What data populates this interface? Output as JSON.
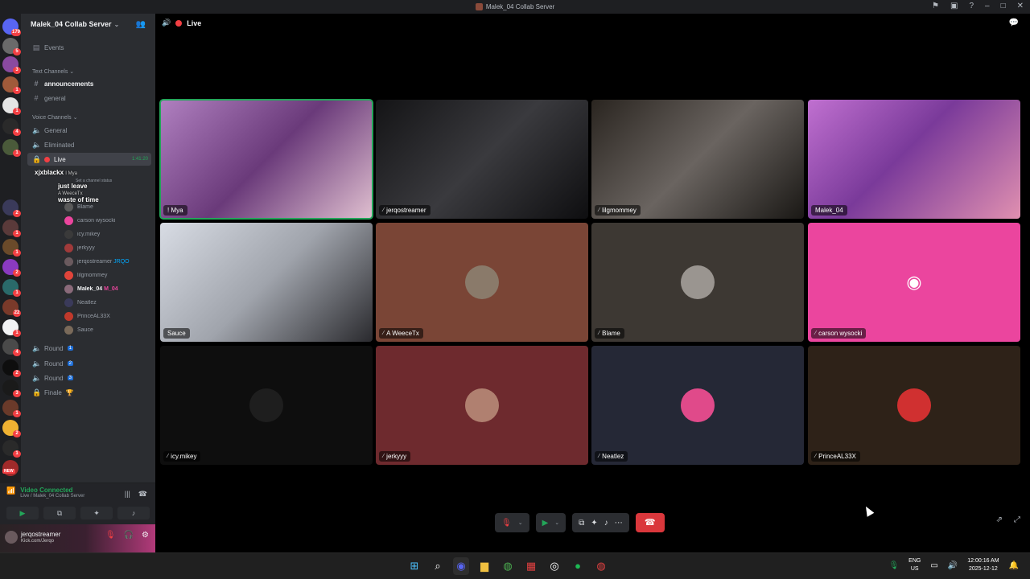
{
  "window": {
    "title": "Malek_04 Collab Server"
  },
  "server": {
    "name": "Malek_04 Collab Server"
  },
  "channels": {
    "events": "Events",
    "text_category": "Text Channels",
    "announcements": "announcements",
    "general_text": "general",
    "voice_category": "Voice Channels",
    "general_voice": "General",
    "eliminated": "Eliminated",
    "live": "Live",
    "live_timer": "1:41:20",
    "status_hint": "Set a channel status",
    "round1": "Round",
    "round2": "Round",
    "round3": "Round",
    "finale": "Finale"
  },
  "overlay_chat": [
    {
      "user": "xjxblackx",
      "message": "",
      "sub": "I Mya"
    },
    {
      "user": "",
      "message": "just leave",
      "sub": "A WeeceTx"
    },
    {
      "user": "",
      "message": "waste of time",
      "sub": ""
    }
  ],
  "voice_members": [
    {
      "name": "I Mya",
      "color": "#c97aa8"
    },
    {
      "name": "A WeeceTx",
      "color": "#8a5a40"
    },
    {
      "name": "Blame",
      "color": "#5a5a5a"
    },
    {
      "name": "carson wysocki",
      "color": "#eb459e"
    },
    {
      "name": "icy.mikey",
      "color": "#3a3a3a"
    },
    {
      "name": "jerkyyy",
      "color": "#a03a3a"
    },
    {
      "name": "jerqostreamer",
      "tag": "JRQO",
      "color": "#6a5a5e"
    },
    {
      "name": "lilgmommey",
      "color": "#e0443a"
    },
    {
      "name": "Malek_04",
      "tag": "M_04",
      "color": "#8a6a7a"
    },
    {
      "name": "Neatlez",
      "color": "#3a3a5a"
    },
    {
      "name": "PrinceAL33X",
      "color": "#c0392b"
    },
    {
      "name": "Sauce",
      "color": "#7a6a5a"
    }
  ],
  "voice_panel": {
    "status": "Video Connected",
    "channel": "Live / Malek_04 Collab Server"
  },
  "user": {
    "name": "jerqostreamer",
    "status": "Kick.com/Jerqo"
  },
  "call": {
    "channel": "Live"
  },
  "tiles": [
    {
      "name": "! Mya",
      "bg": "#7a4a8a",
      "video": true,
      "speaking": true
    },
    {
      "name": "jerqostreamer",
      "bg": "#2a2a2e",
      "video": true
    },
    {
      "name": "lilgmommey",
      "bg": "#3a3530",
      "video": true
    },
    {
      "name": "Malek_04",
      "bg": "#9a5ab0",
      "video": true
    },
    {
      "name": "Sauce",
      "bg": "#b8bcc4",
      "video": true
    },
    {
      "name": "A WeeceTx",
      "bg": "#7a4536",
      "avatar": "#8a7a6a"
    },
    {
      "name": "Blame",
      "bg": "#3d3833",
      "avatar": "#9a9590"
    },
    {
      "name": "carson wysocki",
      "bg": "#eb459e",
      "discord": true
    },
    {
      "name": "icy.mikey",
      "bg": "#0e0e0e",
      "avatar": "#1e1e1e"
    },
    {
      "name": "jerkyyy",
      "bg": "#6e2a2e",
      "avatar": "#b08070"
    },
    {
      "name": "Neatlez",
      "bg": "#252836",
      "avatar": "#e04a8a"
    },
    {
      "name": "PrinceAL33X",
      "bg": "#2e2218",
      "avatar": "#d03030"
    }
  ],
  "icons": {
    "mic_off": "microphone-muted-icon",
    "camera": "camera-icon",
    "screenshare": "screen-share-icon",
    "activities": "activities-icon",
    "soundboard": "soundboard-icon",
    "more": "more-icon",
    "hangup": "hang-up-icon"
  },
  "taskbar": {
    "lang": "ENG",
    "region": "US",
    "time": "12:00:16 AM",
    "date": "2025-12-12"
  },
  "rail_badges": [
    "179",
    "5",
    "3",
    "1",
    "1",
    "4",
    "1",
    "3",
    "8",
    "2",
    "1",
    "1",
    "2",
    "1",
    "1",
    "22",
    "1",
    "4",
    "2",
    "3",
    "1",
    "2",
    "1",
    "4",
    "1",
    "2",
    "3"
  ],
  "rail_new": "NEW",
  "colors": {
    "accent_green": "#23a559",
    "danger_red": "#da373c",
    "discord_pink": "#eb459e"
  }
}
